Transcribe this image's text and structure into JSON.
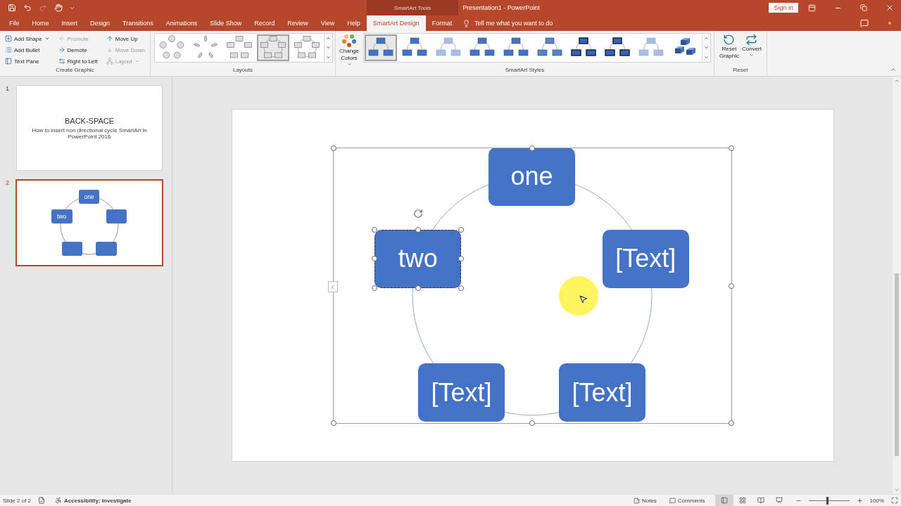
{
  "window": {
    "title": "Presentation1  -  PowerPoint",
    "context_label": "SmartArt Tools",
    "sign_in": "Sign in"
  },
  "quick_access": [
    {
      "kind": "save",
      "disabled": false
    },
    {
      "kind": "undo",
      "disabled": false
    },
    {
      "kind": "redo",
      "disabled": true
    },
    {
      "kind": "touch",
      "disabled": false
    }
  ],
  "tabs": [
    {
      "label": "File",
      "selected": false
    },
    {
      "label": "Home",
      "selected": false
    },
    {
      "label": "Insert",
      "selected": false
    },
    {
      "label": "Design",
      "selected": false
    },
    {
      "label": "Transitions",
      "selected": false
    },
    {
      "label": "Animations",
      "selected": false
    },
    {
      "label": "Slide Show",
      "selected": false
    },
    {
      "label": "Record",
      "selected": false
    },
    {
      "label": "Review",
      "selected": false
    },
    {
      "label": "View",
      "selected": false
    },
    {
      "label": "Help",
      "selected": false
    }
  ],
  "context_tabs": [
    {
      "label": "SmartArt Design",
      "selected": true
    },
    {
      "label": "Format",
      "selected": false
    }
  ],
  "tell_me": {
    "placeholder": "Tell me what you want to do"
  },
  "ribbon": {
    "create_graphic": {
      "label": "Create Graphic",
      "commands": [
        {
          "kind": "add-shape",
          "label": "Add Shape",
          "disabled": false,
          "dropdown": true
        },
        {
          "kind": "add-bullet",
          "label": "Add Bullet",
          "disabled": false,
          "dropdown": false
        },
        {
          "kind": "text-pane",
          "label": "Text Pane",
          "disabled": false,
          "dropdown": false
        },
        {
          "kind": "promote",
          "label": "Promote",
          "disabled": true,
          "dropdown": false
        },
        {
          "kind": "demote",
          "label": "Demote",
          "disabled": false,
          "dropdown": false
        },
        {
          "kind": "right-to-left",
          "label": "Right to Left",
          "disabled": false,
          "dropdown": false
        },
        {
          "kind": "move-up",
          "label": "Move Up",
          "disabled": false,
          "dropdown": false
        },
        {
          "kind": "move-down",
          "label": "Move Down",
          "disabled": true,
          "dropdown": false
        },
        {
          "kind": "layout",
          "label": "Layout",
          "disabled": true,
          "dropdown": true
        }
      ]
    },
    "layouts": {
      "label": "Layouts",
      "items": [
        {
          "kind": "circles",
          "selected": false
        },
        {
          "kind": "segments",
          "selected": false
        },
        {
          "kind": "arrow-boxes",
          "selected": false
        },
        {
          "kind": "ring-boxes",
          "selected": true
        },
        {
          "kind": "linked-boxes",
          "selected": false
        }
      ]
    },
    "change_colors": {
      "label": "Change Colors"
    },
    "styles": {
      "label": "SmartArt Styles",
      "items": [
        {
          "kind": "flat",
          "selected": true
        },
        {
          "kind": "flat",
          "selected": false
        },
        {
          "kind": "light",
          "selected": false
        },
        {
          "kind": "flat",
          "selected": false
        },
        {
          "kind": "flat",
          "selected": false
        },
        {
          "kind": "gradient",
          "selected": false
        },
        {
          "kind": "outline",
          "selected": false
        },
        {
          "kind": "outline",
          "selected": false
        },
        {
          "kind": "light",
          "selected": false
        },
        {
          "kind": "cube",
          "selected": false
        }
      ]
    },
    "reset": {
      "label": "Reset",
      "commands": [
        {
          "kind": "reset",
          "label": "Reset Graphic",
          "dropdown": false
        },
        {
          "kind": "convert",
          "label": "Convert",
          "dropdown": true
        }
      ]
    }
  },
  "slides": [
    {
      "number": "1",
      "selected": false,
      "kind": "title",
      "title": "BACK-SPACE",
      "subtitle": "How to insert non directional cycle SmartArt in PowerPoint 2016"
    },
    {
      "number": "2",
      "selected": true,
      "kind": "smartart",
      "nodes": [
        {
          "text": "one"
        },
        {
          "blank": true
        },
        {
          "blank": true
        },
        {
          "blank": true
        },
        {
          "text": "two"
        }
      ]
    }
  ],
  "diagram": {
    "nodes": [
      {
        "text": "one",
        "selected": false
      },
      {
        "text": "[Text]",
        "selected": false
      },
      {
        "text": "[Text]",
        "selected": false
      },
      {
        "text": "[Text]",
        "selected": false
      },
      {
        "text": "two",
        "selected": true
      }
    ]
  },
  "status_bar": {
    "slide": "Slide 2 of 2",
    "accessibility": "Accessibility: Investigate",
    "notes": "Notes",
    "comments": "Comments",
    "views": [
      {
        "kind": "normal",
        "selected": true
      },
      {
        "kind": "sorter",
        "selected": false
      },
      {
        "kind": "reading",
        "selected": false
      },
      {
        "kind": "slideshow",
        "selected": false
      }
    ],
    "zoom": {
      "level": 0.45,
      "reading": "100%"
    }
  }
}
